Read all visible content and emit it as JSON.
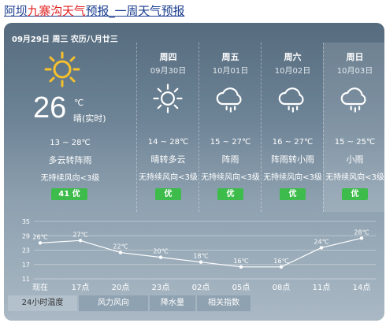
{
  "title": {
    "part1": "阿坝",
    "part2": "九寨沟天气",
    "part3": "预报_一周天气预报"
  },
  "header_date": "09月29日 周三 农历八月廿三",
  "today": {
    "temp": "26",
    "unit": "℃",
    "label": "晴(实时)",
    "range": "13 ~ 28℃",
    "condition": "多云转阵雨",
    "wind": "无持续风向<3级",
    "aqi": "41 优",
    "icon": "sun-icon"
  },
  "days": [
    {
      "name": "周四",
      "date": "09月30日",
      "range": "14 ~ 28℃",
      "condition": "晴转多云",
      "wind": "无持续风向<3级",
      "aqi": "优",
      "icon": "sun-icon"
    },
    {
      "name": "周五",
      "date": "10月01日",
      "range": "15 ~ 27℃",
      "condition": "阵雨",
      "wind": "无持续风向<3级",
      "aqi": "优",
      "icon": "rain-cloud-icon"
    },
    {
      "name": "周六",
      "date": "10月02日",
      "range": "16 ~ 27℃",
      "condition": "阵雨转小雨",
      "wind": "无持续风向<3级",
      "aqi": "优",
      "icon": "rain-cloud-icon"
    },
    {
      "name": "周日",
      "date": "10月03日",
      "range": "15 ~ 25℃",
      "condition": "小雨",
      "wind": "无持续风向<3级",
      "aqi": "优",
      "icon": "rain-cloud-icon"
    }
  ],
  "chart_data": {
    "type": "line",
    "categories": [
      "现在",
      "17点",
      "20点",
      "23点",
      "02点",
      "05点",
      "08点",
      "11点",
      "14点"
    ],
    "values": [
      26,
      27,
      22,
      20,
      18,
      16,
      16,
      24,
      28
    ],
    "value_labels": [
      "26℃",
      "27℃",
      "22℃",
      "20℃",
      "18℃",
      "16℃",
      "16℃",
      "24℃",
      "28℃"
    ],
    "yticks": [
      "35",
      "29",
      "23",
      "17",
      "11"
    ],
    "ylim": [
      11,
      35
    ],
    "grid": true
  },
  "tabs": [
    {
      "label": "24小时温度",
      "active": true
    },
    {
      "label": "风力风向",
      "active": false
    },
    {
      "label": "降水量",
      "active": false
    },
    {
      "label": "相关指数",
      "active": false
    }
  ],
  "colors": {
    "aqi_good": "#3dbb4b",
    "title_link": "#1a3d8f",
    "title_red": "#e02020",
    "sun": "#f7c12c"
  }
}
